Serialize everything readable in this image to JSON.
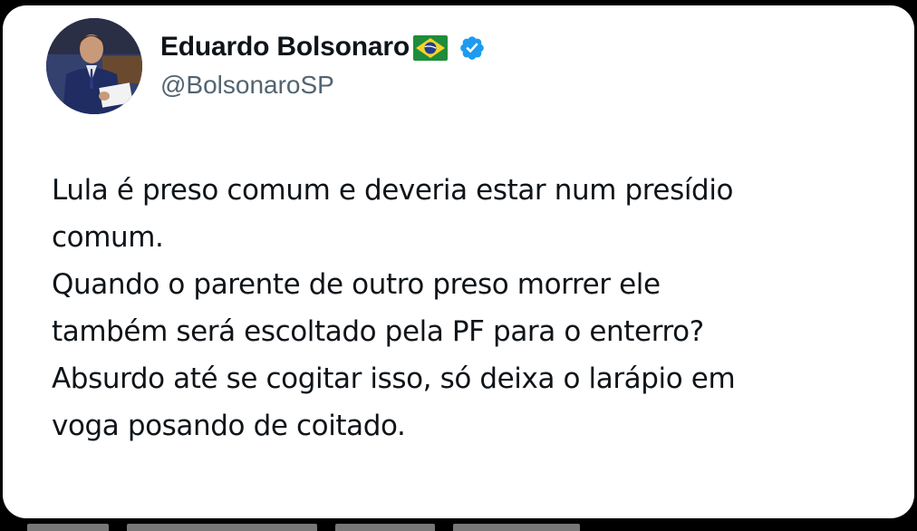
{
  "tweet": {
    "author": {
      "display_name": "Eduardo Bolsonaro",
      "handle": "@BolsonaroSP",
      "flag_icon": "brazil-flag-emoji",
      "verified_icon": "verified-badge",
      "verified_color": "#1d9bf0"
    },
    "lines": [
      "Lula é preso comum e deveria estar num presídio",
      "comum.",
      "Quando o parente de outro preso morrer ele",
      "também será escoltado pela PF para o enterro?",
      "Absurdo até se cogitar isso, só deixa o larápio em",
      "voga posando de coitado."
    ]
  },
  "colors": {
    "background": "#000000",
    "card": "#ffffff",
    "text": "#0f1419",
    "handle": "#536471"
  }
}
